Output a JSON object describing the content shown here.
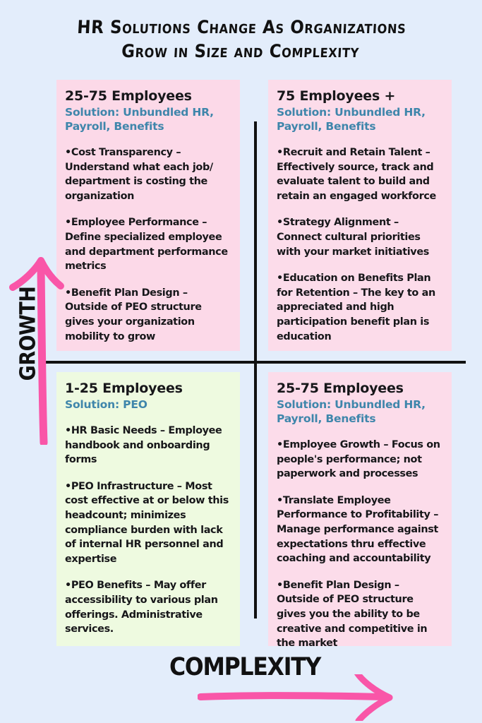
{
  "title": {
    "line1": "HR Solutions Change As Organizations",
    "line2": "Grow in Size and Complexity"
  },
  "colors": {
    "background": "#e3edfb",
    "card_pink": "#fcdcea",
    "card_green": "#eefae0",
    "accent_pink_arrow": "#f956a8",
    "solution_blue": "#3f86ab",
    "text_dark": "#17171a",
    "divider_black": "#111111"
  },
  "axes": {
    "vertical_label": "GROWTH",
    "horizontal_label": "COMPLEXITY"
  },
  "quadrants": {
    "top_left": {
      "heading": "25-75 Employees",
      "solution": "Solution: Unbundled HR, Payroll, Benefits",
      "bullets": [
        "Cost Transparency – Understand what each job/ department is costing the organization",
        "Employee Performance – Define specialized employee and department performance metrics",
        "Benefit Plan Design – Outside of PEO structure gives your organization mobility to grow"
      ]
    },
    "top_right": {
      "heading": "75 Employees +",
      "solution": "Solution: Unbundled HR, Payroll, Benefits",
      "bullets": [
        "Recruit and Retain Talent – Effectively source, track and evaluate talent to build and retain an engaged workforce",
        "Strategy Alignment – Connect cultural priorities with your market initiatives",
        "Education on Benefits Plan for Retention – The key to an appreciated and high participation benefit plan is education"
      ]
    },
    "bottom_left": {
      "heading": "1-25 Employees",
      "solution": "Solution: PEO",
      "bullets": [
        "HR Basic Needs – Employee handbook and onboarding forms",
        "PEO Infrastructure – Most cost effective at or below this headcount; minimizes compliance burden with lack of internal HR personnel and expertise",
        "PEO Benefits – May offer accessibility to various plan offerings.  Administrative services."
      ]
    },
    "bottom_right": {
      "heading": "25-75 Employees",
      "solution": "Solution: Unbundled HR, Payroll, Benefits",
      "bullets": [
        "Employee Growth – Focus on people's performance; not paperwork and processes",
        "Translate Employee Performance to Profitability – Manage performance against expectations thru effective coaching and accountability",
        "Benefit Plan Design – Outside of PEO structure gives you the ability to be creative and competitive in the market"
      ]
    }
  }
}
